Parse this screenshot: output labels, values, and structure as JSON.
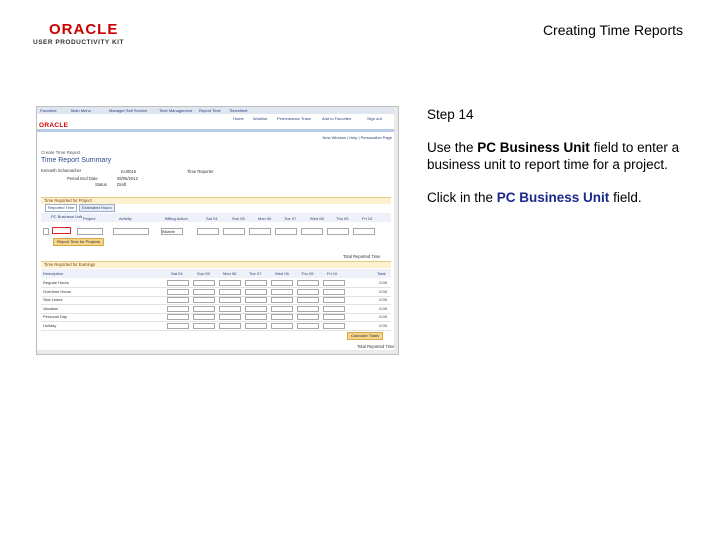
{
  "header": {
    "logo_text": "ORACLE",
    "logo_sub": "USER PRODUCTIVITY KIT",
    "title": "Creating Time Reports"
  },
  "instructions": {
    "step": "Step 14",
    "p1_pre": "Use the ",
    "p1_bold": "PC Business Unit",
    "p1_post": " field to enter a business unit to report time for a project.",
    "p2_pre": "Click in the ",
    "p2_bold": "PC Business Unit",
    "p2_post": " field."
  },
  "screenshot": {
    "nav_links": [
      "Favorites",
      "Main Menu",
      "Manager Self Service",
      "Time Management",
      "Report Time",
      "Timesheet"
    ],
    "menu_links": [
      "Home",
      "Worklist",
      "Performance Trace",
      "Add to Favorites",
      "Sign out"
    ],
    "logo": "ORACLE",
    "top_links": "New Window | Help | Personalize Page",
    "breadcrumb": "Create Time Report",
    "page_title": "Time Report Summary",
    "employee": "Kenneth Schumacher",
    "employee_id": "KU0015",
    "time_reporter": "Time Reporter",
    "period_label": "Period End Date",
    "period_value": "05/05/2012",
    "status_label": "Status",
    "status_value": "Draft",
    "section1": "Time Reported for Project",
    "tab1": "Reported Time",
    "tab2": "Estimated Hours",
    "columns1": [
      "PC Business Unit",
      "Project",
      "Activity",
      "Billing Action",
      "Sat 04",
      "Sun 05",
      "Mon 06",
      "Tue 07",
      "Wed 08",
      "Thu 09",
      "Fri 10"
    ],
    "billing_value": "Billable",
    "add_button": "Report Time for Projects",
    "total_label": "Total Reported Time",
    "section2": "Time Reported for Earnings",
    "columns2": [
      "Description",
      "Sat 04",
      "Sun 05",
      "Mon 06",
      "Tue 07",
      "Wed 08",
      "Thu 09",
      "Fri 10",
      "Total"
    ],
    "rows": [
      {
        "label": "Regular Hours",
        "total": "0.00"
      },
      {
        "label": "Overtime Hours",
        "total": "0.00"
      },
      {
        "label": "Sick Leave",
        "total": "0.00"
      },
      {
        "label": "Vacation",
        "total": "0.00"
      },
      {
        "label": "Personal Day",
        "total": "0.00"
      },
      {
        "label": "Holiday",
        "total": "0.00"
      }
    ],
    "calc_button": "Calculate Totals",
    "footer": "Total Reported Time"
  },
  "colors": {
    "accent_red": "#cc0000",
    "highlight_red": "#e3201b",
    "link_blue": "#2a3f7a"
  }
}
